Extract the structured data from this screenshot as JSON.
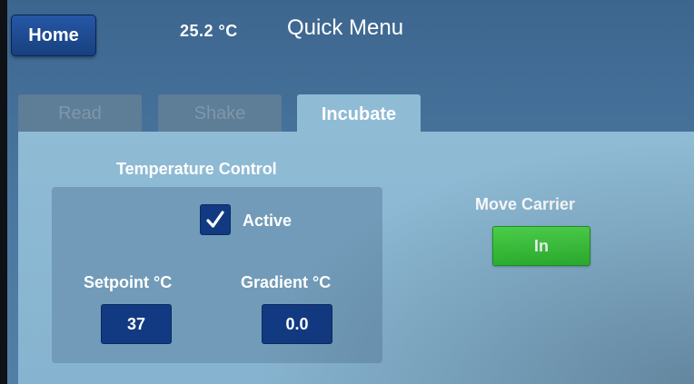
{
  "header": {
    "home_label": "Home",
    "current_temperature": "25.2 °C",
    "title": "Quick Menu"
  },
  "tabs": [
    {
      "label": "Read",
      "selected": false
    },
    {
      "label": "Shake",
      "selected": false
    },
    {
      "label": "Incubate",
      "selected": true
    }
  ],
  "temperature_control": {
    "title": "Temperature Control",
    "active_label": "Active",
    "active_checked": true,
    "setpoint_label": "Setpoint °C",
    "setpoint_value": "37",
    "gradient_label": "Gradient °C",
    "gradient_value": "0.0"
  },
  "move_carrier": {
    "title": "Move Carrier",
    "button_label": "In"
  },
  "icons": {
    "checkbox": "checkmark-icon"
  },
  "colors": {
    "background": "#4b78a0",
    "panel": "#8fbbd5",
    "inner_panel": "#719bb8",
    "value_box": "#123a82",
    "action_green": "#3cc93c",
    "home_button": "#1f4c94"
  }
}
